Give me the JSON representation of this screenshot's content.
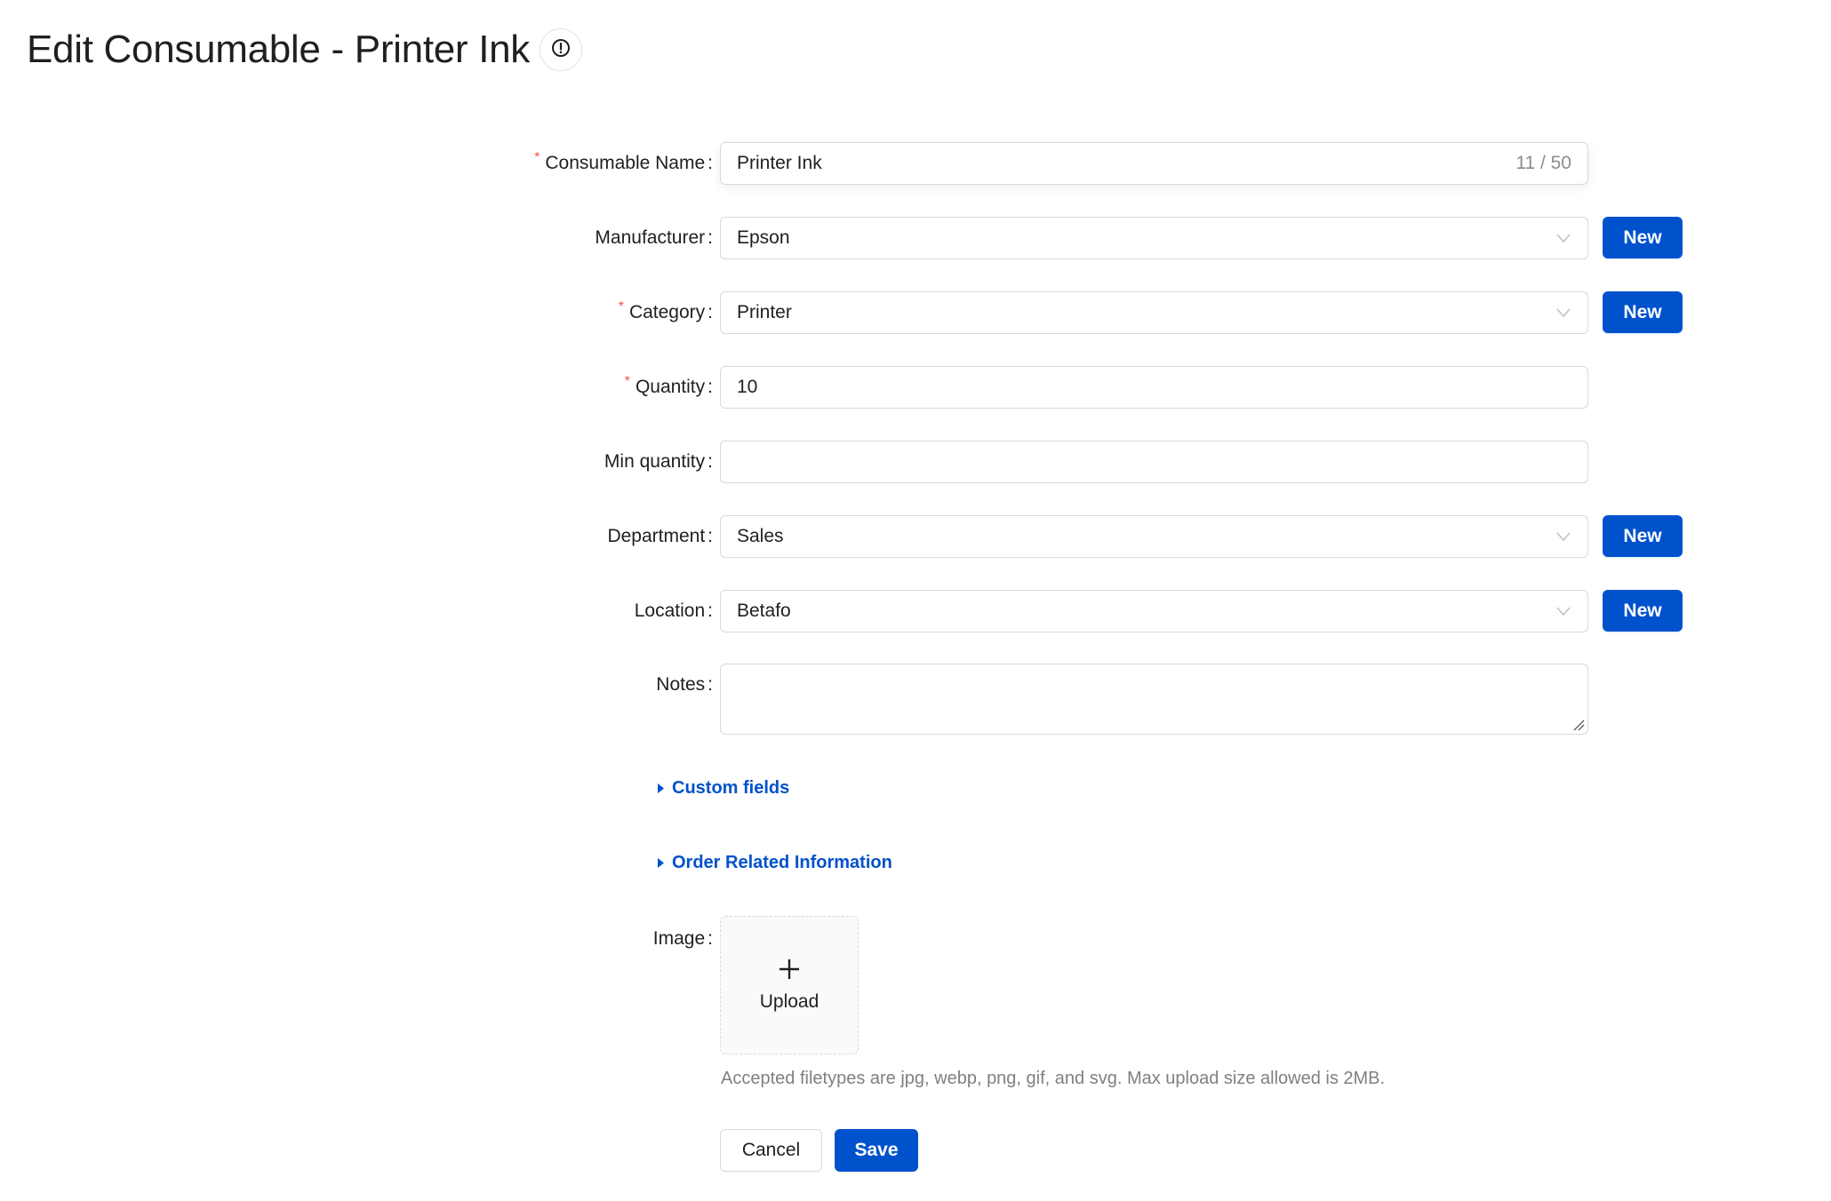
{
  "header": {
    "title": "Edit Consumable - Printer Ink",
    "info_icon": "exclamation-circle-icon"
  },
  "form": {
    "name": {
      "label": "Consumable Name",
      "required": true,
      "value": "Printer Ink",
      "count": "11 / 50"
    },
    "manufacturer": {
      "label": "Manufacturer",
      "required": false,
      "value": "Epson",
      "new_label": "New"
    },
    "category": {
      "label": "Category",
      "required": true,
      "value": "Printer",
      "new_label": "New"
    },
    "quantity": {
      "label": "Quantity",
      "required": true,
      "value": "10"
    },
    "min_quantity": {
      "label": "Min quantity",
      "required": false,
      "value": ""
    },
    "department": {
      "label": "Department",
      "required": false,
      "value": "Sales",
      "new_label": "New"
    },
    "location": {
      "label": "Location",
      "required": false,
      "value": "Betafo",
      "new_label": "New"
    },
    "notes": {
      "label": "Notes",
      "required": false,
      "value": ""
    },
    "colon": ":",
    "required_mark": "*",
    "custom_fields_label": "Custom fields",
    "order_info_label": "Order Related Information",
    "image": {
      "label": "Image",
      "upload_label": "Upload",
      "help_text": "Accepted filetypes are jpg, webp, png, gif, and svg. Max upload size allowed is 2MB."
    }
  },
  "actions": {
    "cancel_label": "Cancel",
    "save_label": "Save"
  },
  "colors": {
    "primary": "#0052cc",
    "required": "#ff4d4f",
    "border": "#d9d9d9",
    "help_text": "#808080"
  }
}
